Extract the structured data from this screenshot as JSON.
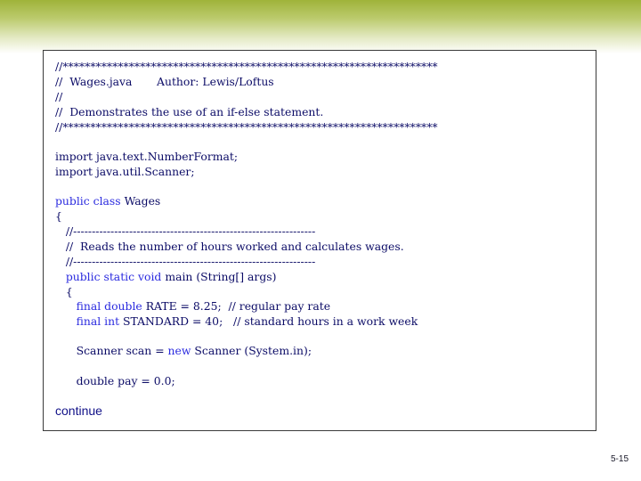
{
  "code": {
    "l1": "//********************************************************************",
    "l2": "//  Wages.java       Author: Lewis/Loftus",
    "l3": "//",
    "l4": "//  Demonstrates the use of an if-else statement.",
    "l5": "//********************************************************************",
    "l6": "import java.text.NumberFormat;",
    "l7": "import java.util.Scanner;",
    "l8_kw": "public class",
    "l8_rest": " Wages",
    "l9": "{",
    "l10": "   //-----------------------------------------------------------------",
    "l11": "   //  Reads the number of hours worked and calculates wages.",
    "l12": "   //-----------------------------------------------------------------",
    "l13_kw": "   public static void",
    "l13_rest": " main (String[] args)",
    "l14": "   {",
    "l15_kw": "      final double",
    "l15_rest": " RATE = 8.25;  // regular pay rate",
    "l16_kw": "      final int",
    "l16_rest": " STANDARD = 40;   // standard hours in a work week",
    "l17_a": "      Scanner scan = ",
    "l17_kw": "new",
    "l17_b": " Scanner (System.in);",
    "l18": "      double pay = 0.0;"
  },
  "continue_label": "continue",
  "page_number": "5-15"
}
